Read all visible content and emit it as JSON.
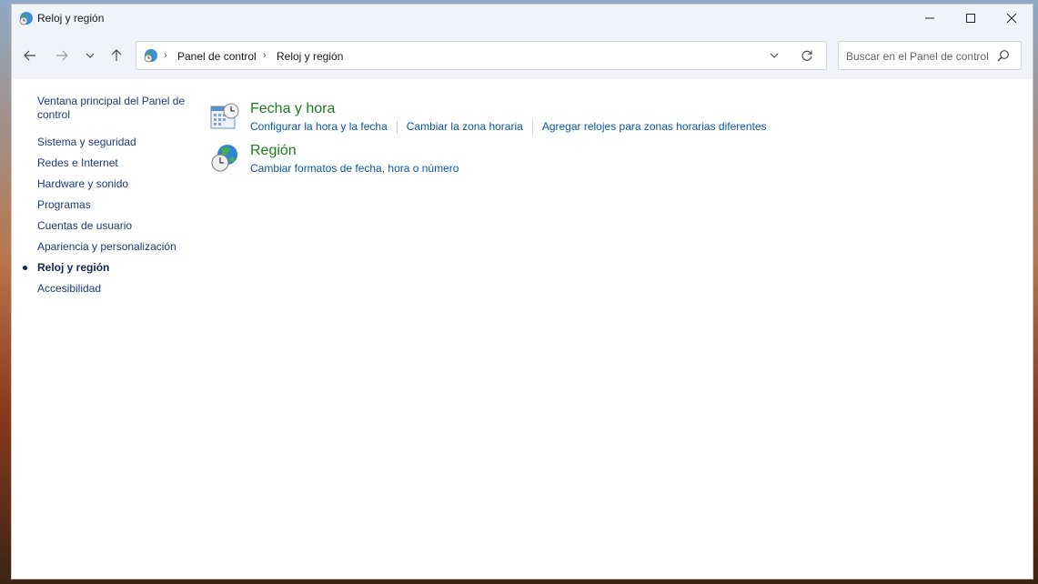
{
  "window": {
    "title": "Reloj y región"
  },
  "address_bar": {
    "breadcrumbs": [
      "Panel de control",
      "Reloj y región"
    ]
  },
  "search": {
    "placeholder": "Buscar en el Panel de control"
  },
  "left_nav": {
    "home": "Ventana principal del Panel de control",
    "items": [
      {
        "label": "Sistema y seguridad",
        "active": false
      },
      {
        "label": "Redes e Internet",
        "active": false
      },
      {
        "label": "Hardware y sonido",
        "active": false
      },
      {
        "label": "Programas",
        "active": false
      },
      {
        "label": "Cuentas de usuario",
        "active": false
      },
      {
        "label": "Apariencia y personalización",
        "active": false
      },
      {
        "label": "Reloj y región",
        "active": true
      },
      {
        "label": "Accesibilidad",
        "active": false
      }
    ]
  },
  "categories": [
    {
      "title": "Fecha y hora",
      "icon": "calendar-clock-icon",
      "links": [
        "Configurar la hora y la fecha",
        "Cambiar la zona horaria",
        "Agregar relojes para zonas horarias diferentes"
      ]
    },
    {
      "title": "Región",
      "icon": "globe-clock-icon",
      "links": [
        "Cambiar formatos de fecha, hora o número"
      ]
    }
  ],
  "colors": {
    "category_title": "#1e7a1e",
    "link": "#0a56a6",
    "nav_link": "#1a3a7a"
  }
}
